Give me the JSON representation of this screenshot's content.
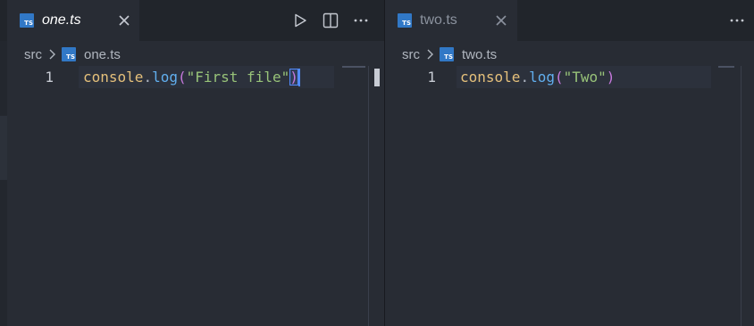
{
  "colors": {
    "accent": "#528bff",
    "ts_icon": "#3178c6",
    "editor_bg": "#282c34",
    "tabbar_bg": "#21252b"
  },
  "left_group": {
    "tab": {
      "icon": "typescript-icon",
      "icon_text": "TS",
      "label": "one.ts",
      "close_icon": "close-icon"
    },
    "actions": [
      {
        "name": "run-icon"
      },
      {
        "name": "split-editor-icon"
      },
      {
        "name": "more-actions-icon"
      }
    ],
    "breadcrumb": {
      "folder": "src",
      "file": "one.ts",
      "icon_text": "TS"
    },
    "editor": {
      "line_number": "1",
      "tokens": {
        "obj": "console",
        "dot": ".",
        "fn": "log",
        "open": "(",
        "str": "\"First file\"",
        "close": ")"
      }
    }
  },
  "right_group": {
    "tab": {
      "icon": "typescript-icon",
      "icon_text": "TS",
      "label": "two.ts",
      "close_icon": "close-icon"
    },
    "actions": [
      {
        "name": "more-actions-icon"
      }
    ],
    "breadcrumb": {
      "folder": "src",
      "file": "two.ts",
      "icon_text": "TS"
    },
    "editor": {
      "line_number": "1",
      "tokens": {
        "obj": "console",
        "dot": ".",
        "fn": "log",
        "open": "(",
        "str": "\"Two\"",
        "close": ")"
      }
    }
  }
}
